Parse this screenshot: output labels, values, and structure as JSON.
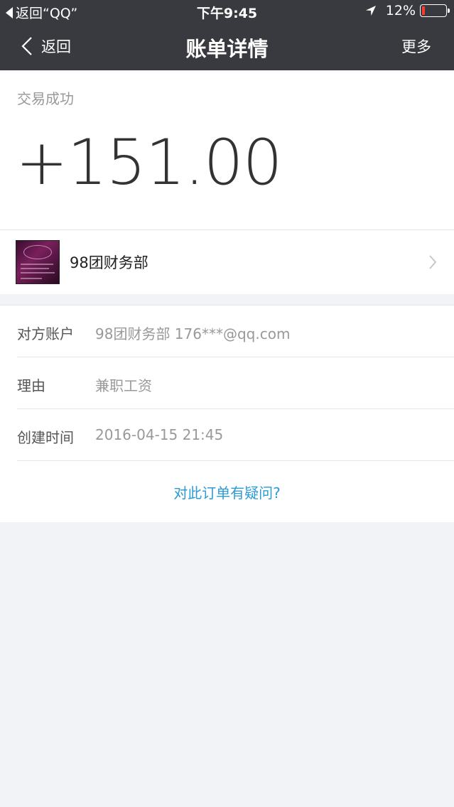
{
  "status_bar": {
    "back_app": "返回“QQ”",
    "time": "下午9:45",
    "battery": "12%",
    "battery_level": 0.12
  },
  "nav": {
    "back_label": "返回",
    "title": "账单详情",
    "more_label": "更多"
  },
  "transaction": {
    "status": "交易成功",
    "amount": "+151.00"
  },
  "merchant": {
    "name": "98团财务部"
  },
  "details": [
    {
      "label": "对方账户",
      "value": "98团财务部 176***@qq.com"
    },
    {
      "label": "理由",
      "value": "兼职工资"
    },
    {
      "label": "创建时间",
      "value": "2016-04-15 21:45"
    }
  ],
  "help_link": "对此订单有疑问?",
  "colors": {
    "header_bg": "#393a3f",
    "link": "#2b9bd6",
    "battery_low": "#ff3b30"
  }
}
